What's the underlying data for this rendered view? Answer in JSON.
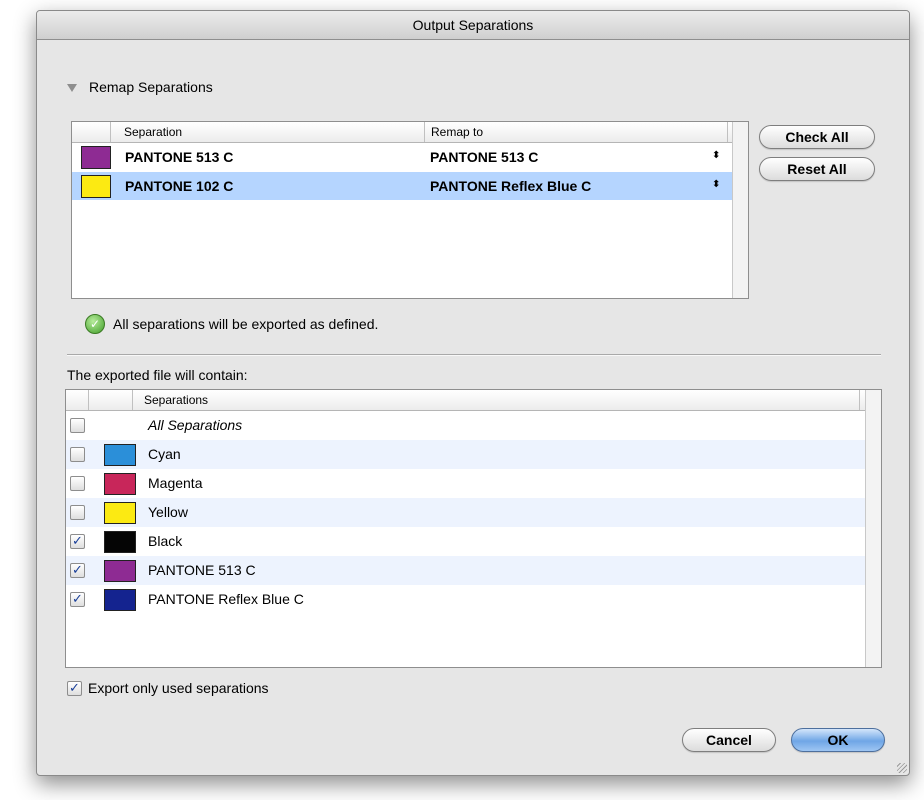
{
  "window": {
    "title": "Output Separations"
  },
  "remap": {
    "section_label": "Remap Separations",
    "columns": {
      "separation": "Separation",
      "remap_to": "Remap to"
    },
    "rows": [
      {
        "color": "#8e2b93",
        "separation": "PANTONE 513 C",
        "remap_to": "PANTONE 513 C",
        "stepper": "⬍",
        "selected": false
      },
      {
        "color": "#fcea12",
        "separation": "PANTONE 102 C",
        "remap_to": "PANTONE Reflex Blue C",
        "stepper": "⬍",
        "selected": true
      }
    ],
    "check_all": "Check All",
    "reset_all": "Reset All"
  },
  "status": {
    "icon": "checkmark-circle-icon",
    "text": "All separations will be exported as defined."
  },
  "exported": {
    "caption": "The exported file will contain:",
    "column": "Separations",
    "rows": [
      {
        "checked": false,
        "color": null,
        "name": "All Separations",
        "italic": true
      },
      {
        "checked": false,
        "color": "#2b8fd9",
        "name": "Cyan"
      },
      {
        "checked": false,
        "color": "#c8265a",
        "name": "Magenta"
      },
      {
        "checked": false,
        "color": "#fcea12",
        "name": "Yellow"
      },
      {
        "checked": true,
        "color": "#050505",
        "name": "Black"
      },
      {
        "checked": true,
        "color": "#8e2b93",
        "name": "PANTONE 513 C"
      },
      {
        "checked": true,
        "color": "#14238f",
        "name": "PANTONE Reflex Blue C"
      }
    ]
  },
  "export_only_used": {
    "checked": true,
    "label": "Export only used separations"
  },
  "buttons": {
    "cancel": "Cancel",
    "ok": "OK"
  }
}
